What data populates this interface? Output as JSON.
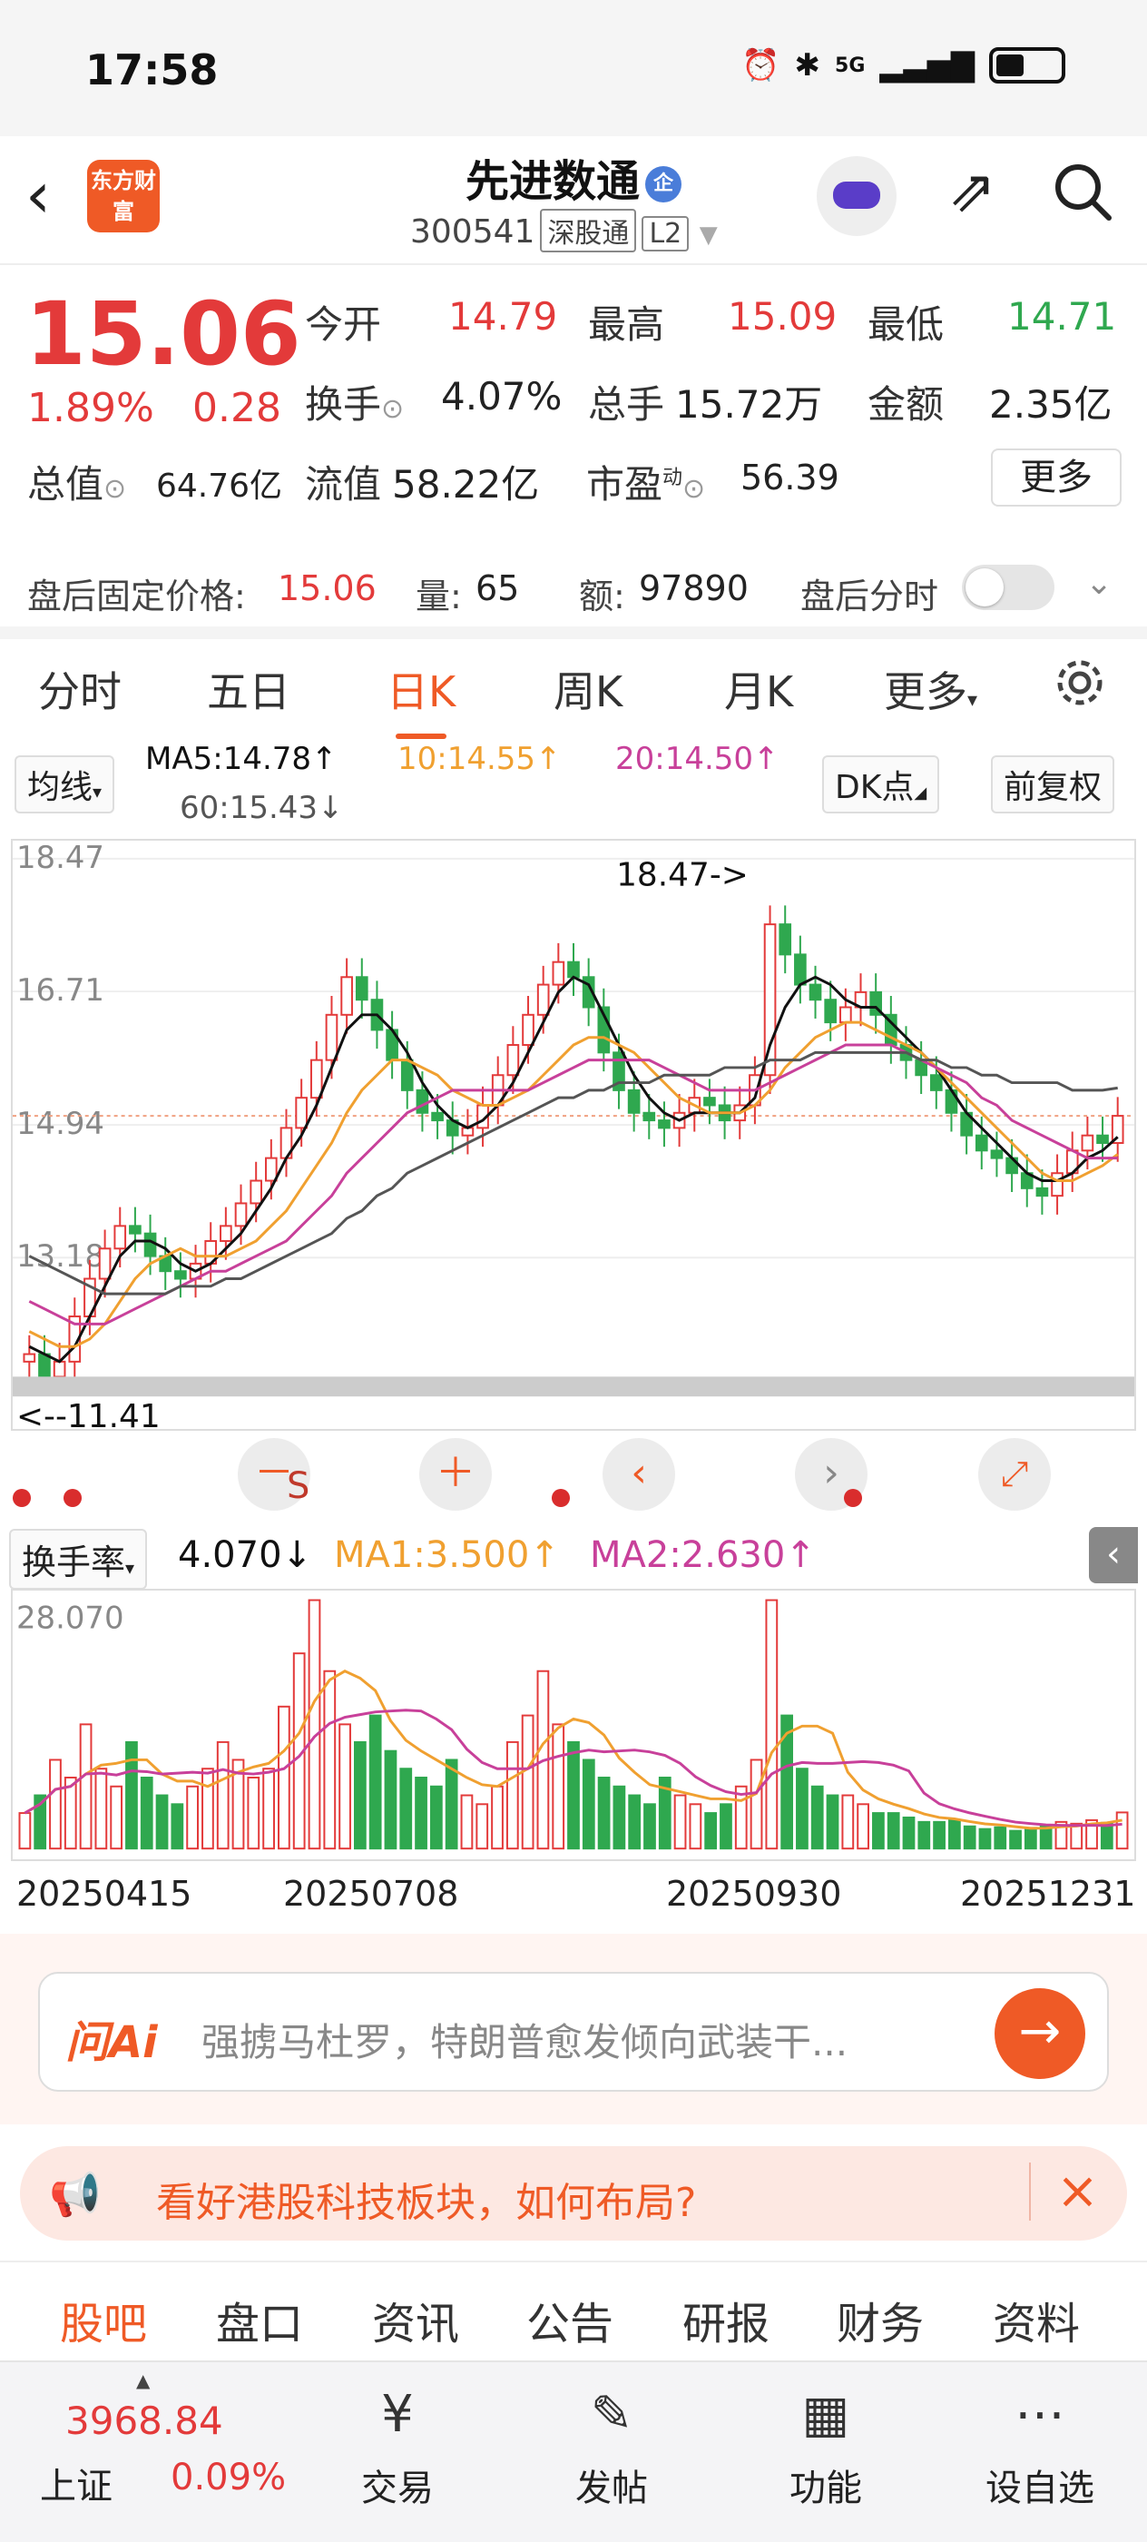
{
  "status_bar": {
    "time": "17:58",
    "network": "5G"
  },
  "header": {
    "logo_text": "东方财富",
    "stock_name": "先进数通",
    "badge": "企",
    "code": "300541",
    "market": "深股通",
    "level": "L2"
  },
  "quote": {
    "price": "15.06",
    "change_pct": "1.89%",
    "change": "0.28",
    "open_label": "今开",
    "open": "14.79",
    "high_label": "最高",
    "high": "15.09",
    "low_label": "最低",
    "low": "14.71",
    "turnover_label": "换手",
    "turnover": "4.07%",
    "volume_label": "总手",
    "volume": "15.72万",
    "amount_label": "金额",
    "amount": "2.35亿",
    "mktcap_label": "总值",
    "mktcap": "64.76亿",
    "float_label": "流值",
    "float": "58.22亿",
    "pe_label": "市盈",
    "pe_sup": "动",
    "pe": "56.39",
    "more": "更多"
  },
  "after_hours": {
    "price_label": "盘后固定价格:",
    "price": "15.06",
    "vol_label": "量:",
    "vol": "65",
    "amt_label": "额:",
    "amt": "97890",
    "toggle_label": "盘后分时"
  },
  "k_tabs": [
    "分时",
    "五日",
    "日K",
    "周K",
    "月K",
    "更多"
  ],
  "ma_row": {
    "selector": "均线",
    "ma5": "MA5:14.78↑",
    "ma10": "10:14.55↑",
    "ma20": "20:14.50↑",
    "ma60": "60:15.43↓",
    "dk": "DK点",
    "adjust": "前复权"
  },
  "colors": {
    "up": "#e33a3a",
    "down": "#2fa84f",
    "ma5": "#111111",
    "ma10": "#f0a030",
    "ma20": "#c8409a",
    "ma60": "#555555",
    "accent": "#ef5a26"
  },
  "chart_data": [
    {
      "type": "candlestick",
      "y_ticks": [
        "18.47",
        "16.71",
        "14.94",
        "13.18"
      ],
      "ylim": [
        11.41,
        18.47
      ],
      "max_annotation": "18.47->",
      "min_annotation": "<--11.41",
      "x_ticks": [
        "20250415",
        "20250708",
        "20250930",
        "20251231"
      ],
      "close": [
        11.9,
        11.6,
        11.8,
        12.4,
        12.9,
        13.3,
        13.6,
        13.5,
        13.2,
        13.0,
        12.9,
        13.1,
        13.4,
        13.6,
        13.9,
        14.2,
        14.5,
        14.9,
        15.3,
        15.8,
        16.4,
        16.9,
        16.6,
        16.2,
        15.8,
        15.4,
        15.1,
        15.0,
        14.8,
        14.9,
        15.2,
        15.6,
        16.0,
        16.4,
        16.8,
        17.1,
        16.9,
        16.5,
        15.9,
        15.4,
        15.1,
        15.0,
        14.9,
        15.1,
        15.3,
        15.2,
        15.0,
        15.2,
        15.6,
        17.6,
        17.2,
        16.8,
        16.6,
        16.3,
        16.5,
        16.7,
        16.4,
        16.0,
        15.8,
        15.6,
        15.4,
        15.1,
        14.8,
        14.6,
        14.5,
        14.3,
        14.1,
        14.0,
        14.3,
        14.6,
        14.8,
        14.7,
        15.06
      ],
      "ma_series": [
        {
          "name": "MA5",
          "values": [
            12.0,
            11.9,
            11.8,
            12.0,
            12.4,
            12.8,
            13.2,
            13.4,
            13.4,
            13.3,
            13.1,
            13.0,
            13.1,
            13.3,
            13.5,
            13.8,
            14.1,
            14.5,
            14.8,
            15.2,
            15.7,
            16.2,
            16.4,
            16.4,
            16.2,
            15.9,
            15.5,
            15.2,
            15.0,
            14.9,
            15.0,
            15.2,
            15.5,
            15.9,
            16.3,
            16.7,
            16.9,
            16.8,
            16.4,
            16.0,
            15.6,
            15.3,
            15.1,
            15.0,
            15.1,
            15.1,
            15.1,
            15.1,
            15.3,
            16.0,
            16.5,
            16.8,
            16.9,
            16.8,
            16.6,
            16.5,
            16.5,
            16.3,
            16.1,
            15.9,
            15.7,
            15.4,
            15.1,
            14.9,
            14.7,
            14.5,
            14.3,
            14.2,
            14.2,
            14.3,
            14.5,
            14.6,
            14.78
          ]
        },
        {
          "name": "10",
          "values": [
            12.2,
            12.1,
            12.0,
            12.0,
            12.1,
            12.3,
            12.6,
            12.9,
            13.1,
            13.2,
            13.3,
            13.2,
            13.2,
            13.2,
            13.3,
            13.4,
            13.6,
            13.8,
            14.1,
            14.4,
            14.7,
            15.1,
            15.4,
            15.6,
            15.8,
            15.8,
            15.7,
            15.6,
            15.4,
            15.3,
            15.2,
            15.2,
            15.3,
            15.4,
            15.6,
            15.8,
            16.0,
            16.1,
            16.1,
            16.0,
            15.9,
            15.7,
            15.5,
            15.3,
            15.2,
            15.1,
            15.1,
            15.1,
            15.2,
            15.4,
            15.7,
            15.9,
            16.1,
            16.2,
            16.3,
            16.3,
            16.2,
            16.1,
            16.0,
            15.9,
            15.7,
            15.5,
            15.3,
            15.1,
            14.9,
            14.7,
            14.5,
            14.3,
            14.2,
            14.2,
            14.3,
            14.4,
            14.55
          ]
        },
        {
          "name": "20",
          "values": [
            12.6,
            12.5,
            12.4,
            12.3,
            12.3,
            12.3,
            12.4,
            12.5,
            12.6,
            12.7,
            12.8,
            12.9,
            13.0,
            13.0,
            13.1,
            13.2,
            13.3,
            13.4,
            13.6,
            13.8,
            14.0,
            14.3,
            14.5,
            14.7,
            14.9,
            15.1,
            15.2,
            15.3,
            15.4,
            15.4,
            15.4,
            15.4,
            15.4,
            15.4,
            15.5,
            15.6,
            15.7,
            15.8,
            15.8,
            15.8,
            15.8,
            15.8,
            15.7,
            15.6,
            15.5,
            15.4,
            15.4,
            15.4,
            15.4,
            15.5,
            15.6,
            15.7,
            15.8,
            15.9,
            16.0,
            16.0,
            16.0,
            16.0,
            15.9,
            15.8,
            15.7,
            15.6,
            15.5,
            15.3,
            15.2,
            15.0,
            14.9,
            14.8,
            14.7,
            14.6,
            14.5,
            14.5,
            14.5
          ]
        },
        {
          "name": "60",
          "values": [
            13.2,
            13.1,
            13.0,
            12.9,
            12.8,
            12.7,
            12.7,
            12.7,
            12.7,
            12.7,
            12.8,
            12.8,
            12.8,
            12.9,
            12.9,
            13.0,
            13.1,
            13.2,
            13.3,
            13.4,
            13.5,
            13.7,
            13.8,
            14.0,
            14.1,
            14.3,
            14.4,
            14.5,
            14.6,
            14.7,
            14.8,
            14.9,
            15.0,
            15.1,
            15.2,
            15.3,
            15.3,
            15.4,
            15.4,
            15.5,
            15.5,
            15.5,
            15.6,
            15.6,
            15.6,
            15.6,
            15.7,
            15.7,
            15.7,
            15.8,
            15.8,
            15.8,
            15.9,
            15.9,
            15.9,
            15.9,
            15.9,
            15.9,
            15.9,
            15.8,
            15.8,
            15.7,
            15.7,
            15.6,
            15.6,
            15.5,
            15.5,
            15.5,
            15.5,
            15.4,
            15.4,
            15.4,
            15.43
          ]
        }
      ]
    },
    {
      "type": "bar",
      "title": "换手率",
      "current": "4.070↓",
      "ma1_label": "MA1:3.500↑",
      "ma2_label": "MA2:2.630↑",
      "y_max_label": "28.070",
      "ylim": [
        0,
        28.07
      ],
      "values": [
        4,
        6,
        10,
        8,
        14,
        9,
        7,
        12,
        8,
        6,
        5,
        7,
        9,
        12,
        10,
        8,
        9,
        16,
        22,
        28,
        20,
        14,
        12,
        15,
        11,
        9,
        8,
        7,
        10,
        6,
        5,
        7,
        12,
        15,
        20,
        14,
        12,
        10,
        8,
        7,
        6,
        5,
        8,
        6,
        5,
        4,
        5,
        7,
        10,
        28,
        15,
        9,
        7,
        6,
        6,
        5,
        4,
        4,
        3.5,
        3,
        3,
        3.2,
        2.5,
        2.2,
        2.4,
        2,
        2.3,
        2.6,
        3,
        2.8,
        3.2,
        2.9,
        4.07
      ]
    }
  ],
  "controls": {
    "minus": "－",
    "plus": "＋",
    "prev": "‹",
    "next": "›",
    "s_tag": "S"
  },
  "ai": {
    "logo": "问Ai",
    "text": "强掳马杜罗，特朗普愈发倾向武装干..."
  },
  "promo": {
    "text": "看好港股科技板块，如何布局?"
  },
  "bottom_tabs": [
    "股吧",
    "盘口",
    "资讯",
    "公告",
    "研报",
    "财务",
    "资料"
  ],
  "nav": {
    "index_value": "3968.84",
    "index_name": "上证",
    "index_pct": "0.09%",
    "items": [
      "交易",
      "发帖",
      "功能",
      "设自选"
    ]
  }
}
